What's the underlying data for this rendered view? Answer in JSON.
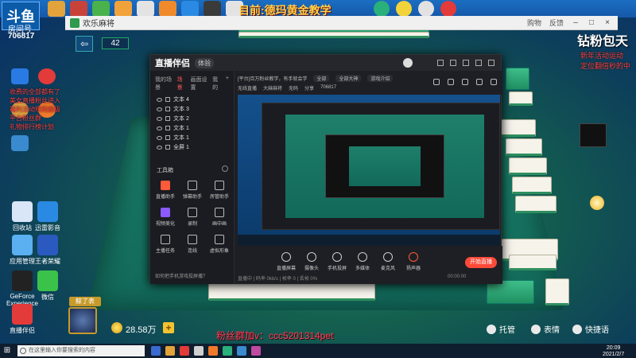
{
  "stream": {
    "logo_text": "斗鱼",
    "room_label": "房间号",
    "room_id": "706817",
    "banner_title": "目前:德玛黄金教学",
    "wechat_watermark": "粉丝群加v：ccc5201314pet",
    "right_big": "钻粉包天",
    "right_red_lines": [
      "新年活动运动",
      "定位翻倍秒的中"
    ]
  },
  "game_window": {
    "title": "欢乐麻将",
    "header_links": [
      "购物",
      "反馈"
    ]
  },
  "game_hud": {
    "tile_count": "42",
    "player_badge": "鲸了表",
    "coins": "28.58万",
    "add_label": "+",
    "buttons": [
      {
        "label": "托管",
        "icon": "robot-icon"
      },
      {
        "label": "表情",
        "icon": "emoji-icon"
      },
      {
        "label": "快捷语",
        "icon": "chat-icon"
      }
    ]
  },
  "desktop_icons": [
    {
      "label": "回收站"
    },
    {
      "label": "迅雷影音"
    },
    {
      "label": "应用管理"
    },
    {
      "label": "王者荣耀"
    },
    {
      "label": "GeForce Experience"
    },
    {
      "label": "微信"
    },
    {
      "label": "直播伴侣"
    }
  ],
  "left_red_text": [
    "收费的全部都有了",
    "美女直播粉丝进入",
    "福利活动规则超级",
    "平台粉丝群",
    "礼物排行榜计划"
  ],
  "app": {
    "name": "直播伴侣",
    "tag": "体验",
    "side_tabs": [
      "我的场景",
      "场景",
      "画面设置",
      "我的",
      "+"
    ],
    "layers": [
      "文本 4",
      "文本 3",
      "文本 2",
      "文本 1",
      "文本 1",
      "全屏 1"
    ],
    "toolbox_title": "工具箱",
    "tools": [
      {
        "label": "直播助手"
      },
      {
        "label": "弹幕助手"
      },
      {
        "label": "房管助手"
      },
      {
        "label": "视频美化"
      },
      {
        "label": "录制"
      },
      {
        "label": "画中画"
      },
      {
        "label": "主播任务"
      },
      {
        "label": "连线"
      },
      {
        "label": "虚拟形象"
      }
    ],
    "footer_text": "如何把手机游戏投屏播？",
    "topbar_line1": "[平台]百万粉丝教学，有手就会学",
    "topbar_pills": [
      "全部",
      "全部大神",
      "游戏介绍"
    ],
    "topbar_line2": [
      "无线直播",
      "大麻麻将",
      "无码",
      "分享",
      "706817"
    ],
    "bottom_tools": [
      "直播屏幕",
      "摄像头",
      "手机投屏",
      "多媒体",
      "麦克风",
      "扬声器"
    ],
    "go_live": "开始直播",
    "status_left": "直播中 | 码率 0kb/s | 帧率 0 | 丢帧 0%",
    "status_time": "00:00:00"
  },
  "taskbar": {
    "search_placeholder": "在这里输入你要搜索的内容",
    "time": "20:09",
    "date": "2021/2/7"
  }
}
